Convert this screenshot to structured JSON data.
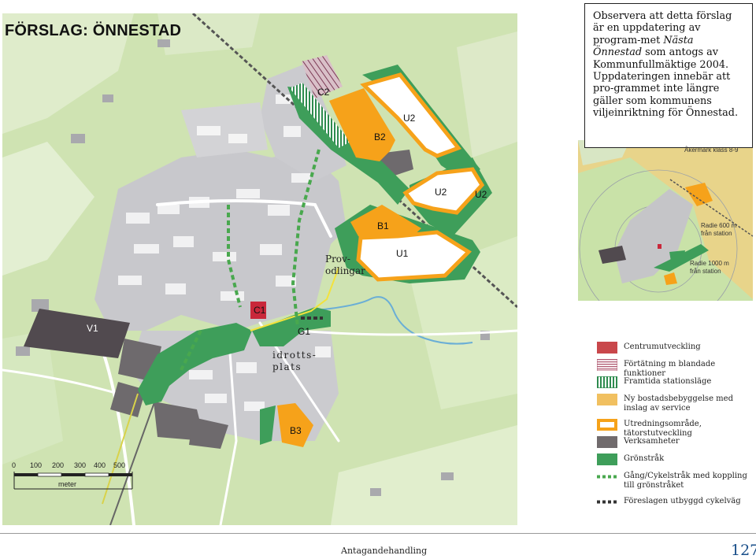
{
  "title": "FÖRSLAG: ÖNNESTAD",
  "notice": {
    "part1": "Observera att detta förslag är en uppdatering av program-met ",
    "italic": "Nästa Önnestad",
    "part2": " som antogs av Kommunfullmäktige 2004. Uppdateringen innebär att pro-grammet inte längre gäller som kommunens viljeinriktning för Önnestad."
  },
  "zone_labels": {
    "c2": "C2",
    "b2": "B2",
    "u2_top": "U2",
    "u2_mid_a": "U2",
    "u2_mid_b": "U2",
    "b1": "B1",
    "u1": "U1",
    "c1": "C1",
    "v1": "V1",
    "g1": "G1",
    "b3": "B3"
  },
  "place_labels": {
    "prov_line1": "Prov-",
    "prov_line2": "odlingar",
    "idrott_line1": "idrotts-",
    "idrott_line2": "plats"
  },
  "inset": {
    "title": "Åkermark klass 8-9",
    "radius600_line1": "Radie 600 m",
    "radius600_line2": "från station",
    "radius1000_line1": "Radie 1000 m",
    "radius1000_line2": "från station"
  },
  "scale_bar": {
    "ticks": [
      "0",
      "100",
      "200",
      "300",
      "400",
      "500"
    ],
    "unit": "meter"
  },
  "legend": [
    {
      "label": "Centrumutveckling",
      "swatch": "centrum",
      "color": "#c9474b"
    },
    {
      "label": "Förtätning m blandade funktioner",
      "swatch": "fortatning",
      "color": "#b05a72"
    },
    {
      "label": "Framtida stationsläge",
      "swatch": "station",
      "color": "#2e8b4f"
    },
    {
      "label": "Ny bostadsbebyggelse med inslag av service",
      "swatch": "bostad",
      "color": "#f1c060"
    },
    {
      "label": "Utredningsområde, tätorstutveckling",
      "swatch": "utredning",
      "color": "#f6a21a"
    },
    {
      "label": "Verksamheter",
      "swatch": "verksamheter",
      "color": "#716b6d"
    },
    {
      "label": "Grönstråk",
      "swatch": "gronstrak",
      "color": "#3e9e5a"
    },
    {
      "label": "Gång/Cykelstråk med koppling till grönstråket",
      "swatch": "gangcykel",
      "color": "#49a84e"
    },
    {
      "label": "Föreslagen utbyggd cykelväg",
      "swatch": "cykelvag",
      "color": "#333333"
    }
  ],
  "footer": {
    "label": "Antagandehandling",
    "page": "127"
  }
}
